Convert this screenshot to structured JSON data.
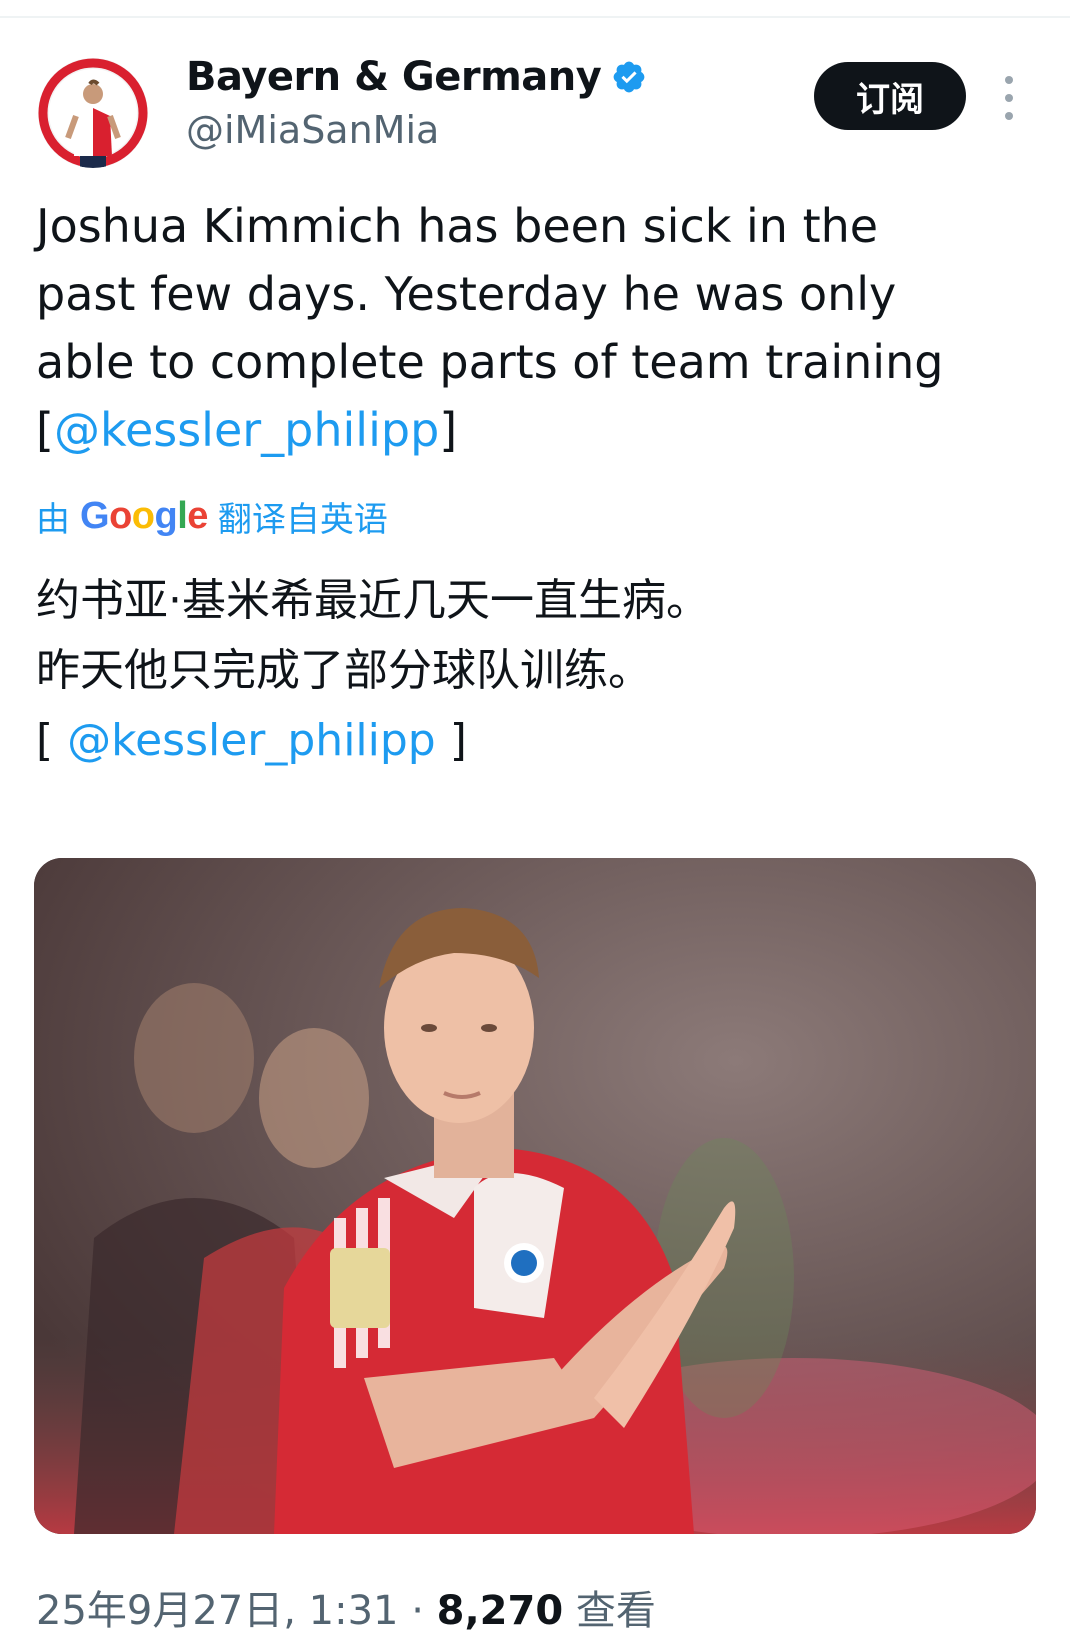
{
  "author": {
    "display_name": "Bayern & Germany",
    "handle": "@iMiaSanMia",
    "verified": true
  },
  "subscribe_label": "订阅",
  "tweet": {
    "lines": [
      "Joshua Kimmich has been sick in the",
      "past few days. Yesterday he was only",
      "able to complete parts of team training"
    ],
    "mention_open": "[",
    "mention": "@kessler_philipp",
    "mention_close": "]"
  },
  "translation": {
    "prefix": "由",
    "provider": "Google",
    "suffix": "翻译自英语",
    "lines": [
      "约书亚·基米希最近几天一直生病。",
      "昨天他只完成了部分球队训练。"
    ],
    "mention_open": "[ ",
    "mention": "@kessler_philipp",
    "mention_close": " ]"
  },
  "media": {
    "alt_icon": "photo-of-player-applauding"
  },
  "footer": {
    "timestamp": "25年9月27日, 1:31",
    "separator": " · ",
    "views_count": "8,270",
    "views_label": " 查看"
  },
  "colors": {
    "accent": "#1d9bf0",
    "text": "#0f1419",
    "muted": "#536471",
    "button_bg": "#0f1419"
  }
}
